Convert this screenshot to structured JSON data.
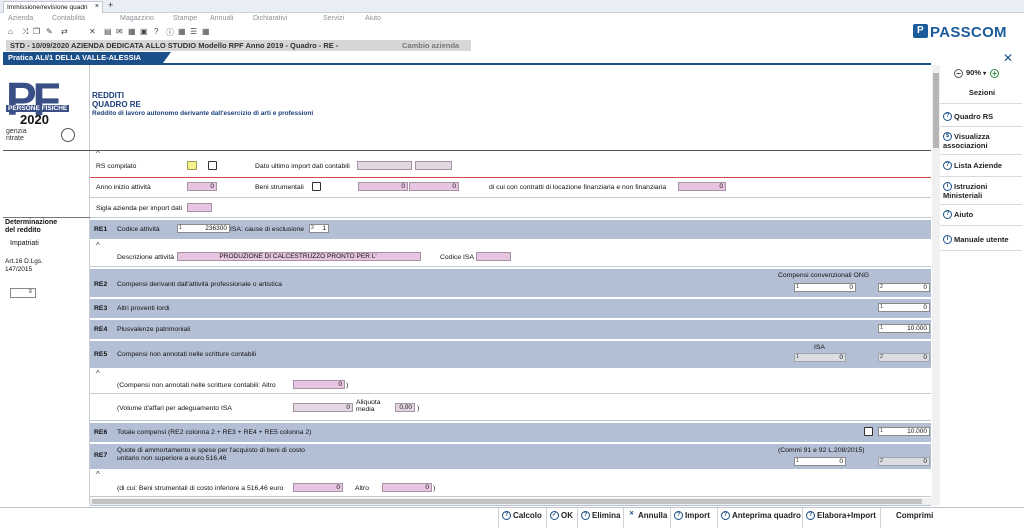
{
  "browser": {
    "tab_title": "Immissione/revisione quadri",
    "close_icon": "×",
    "new_tab": "+"
  },
  "menu": [
    "Azienda",
    "Contabilità",
    "Magazzino",
    "Stampe",
    "Annuali",
    "Dichiarativi",
    "Servizi",
    "Aiuto"
  ],
  "toolbar_icons": [
    "home-icon",
    "shuffle-icon",
    "copy-icon",
    "edit-icon",
    "switch-icon",
    "tools-icon",
    "print-icon",
    "mail-icon",
    "grid-icon",
    "info-icon",
    "help-icon",
    "grid2-icon",
    "list-icon"
  ],
  "brand": {
    "name": "PASSCOM",
    "mark": "P"
  },
  "status": {
    "text": "STD - 10/09/2020 AZIENDA DEDICATA ALLO STUDIO Modello RPF Anno 2019 - Quadro - RE -",
    "link": "Cambio azienda"
  },
  "pratica": "Pratica ALI/1 DELLA VALLE-ALESSIA",
  "logo": {
    "big": "PF",
    "pf": "PERSONE FISICHE",
    "year": "2020",
    "agency": "genzia\nntrate"
  },
  "header": {
    "l1": "REDDITI",
    "l2": "QUADRO RE",
    "l3": "Reddito di lavoro autonomo derivante dall'esercizio di arti e professioni"
  },
  "left": {
    "determ": "Determinazione\ndel reddito",
    "impat": "Impatriati",
    "art": "Art.16 D.Lgs.\n147/2015",
    "sel": "≡"
  },
  "form": {
    "rs_compilato": "RS compilato",
    "ultimo_import": "Dato ultimo import dati contabili",
    "anno_inizio": "Anno inizio attività",
    "anno_val": "0",
    "beni": "Beni strumentali",
    "beni_v1": "0",
    "beni_v2": "0",
    "contratti": "di cui con contratti di locazione finanziaria e non finanziaria",
    "contratti_v": "0",
    "sigla": "Sigla azienda per import dati",
    "re1": "RE1",
    "codice_att": "Codice attività",
    "codice_num": "1",
    "codice_val": "236300",
    "isa_cause": "ISA: cause di esclusione",
    "isa_num": "2",
    "isa_val": "1",
    "descr_att": "Descrizione attività",
    "descr_val": "PRODUZIONE DI CALCESTRUZZO PRONTO PER L'",
    "codice_isa": "Codice ISA",
    "re2": "RE2",
    "re2_lbl": "Compensi derivanti dall'attività professionale o artistica",
    "ong": "Compensi convenzionali ONG",
    "re2_n1": "1",
    "re2_v1": "0",
    "re2_n2": "2",
    "re2_v2": "0",
    "re3": "RE3",
    "re3_lbl": "Altri proventi lordi",
    "re3_n": "1",
    "re3_v": "0",
    "re4": "RE4",
    "re4_lbl": "Plusvalenze patrimoniali",
    "re4_n": "1",
    "re4_v": "10.000",
    "re5": "RE5",
    "re5_lbl": "Compensi non annotati nelle scritture contabili",
    "isa": "ISA",
    "re5_n1": "1",
    "re5_v1": "0",
    "re5_n2": "2",
    "re5_v2": "0",
    "altro_lbl": "(Compensi non annotati nelle scritture contabili: Altro",
    "altro_v": "0",
    "vol_lbl": "(Volume d'affari per adeguamento ISA",
    "vol_v": "0",
    "aliq": "Aliquota\nmedia",
    "aliq_v": "0,00",
    "re6": "RE6",
    "re6_lbl": "Totale compensi (RE2 colonna 2 + RE3 + RE4 + RE5 colonna 2)",
    "re6_n": "1",
    "re6_v": "10.000",
    "re7": "RE7",
    "re7_lbl": "Quote di ammortamento e spese per l'acquisto di beni di costo\nunitario non superiore a euro 516,46",
    "commi": "(Commi 91 e 92 L.208/2015)",
    "re7_n1": "1",
    "re7_v1": "0",
    "re7_n2": "2",
    "re7_v2": "0",
    "dicui_lbl": "(di cui: Beni strumentali di costo inferiore a 516,46 euro",
    "dicui_v": "0",
    "altro2": "Altro",
    "altro2_v": "0"
  },
  "sidebar": {
    "zoom": "90%",
    "sezioni": "Sezioni",
    "items": [
      {
        "label": "Quadro RS",
        "icon": "?"
      },
      {
        "label": "Visualizza\nassociazioni",
        "icon": "$"
      },
      {
        "label": "Lista Aziende",
        "icon": "?"
      },
      {
        "label": "Istruzioni\nMinisteriali",
        "icon": "i"
      },
      {
        "label": "Aiuto",
        "icon": "?"
      },
      {
        "label": "Manuale utente",
        "icon": "i"
      }
    ]
  },
  "bottom": [
    {
      "label": "Calcolo",
      "icon": "?"
    },
    {
      "label": "OK",
      "icon": "✓"
    },
    {
      "label": "Elimina",
      "icon": "?"
    },
    {
      "label": "Annulla",
      "icon": "✕"
    },
    {
      "label": "Import",
      "icon": "?"
    },
    {
      "label": "Anteprima quadro",
      "icon": "?"
    },
    {
      "label": "Elabora+Import",
      "icon": "?"
    },
    {
      "label": "Comprimi",
      "icon": ""
    }
  ],
  "colors": {
    "brand": "#1b5b9a",
    "row_blue": "#b3bfd5",
    "field_pink": "#e7c5e1"
  }
}
